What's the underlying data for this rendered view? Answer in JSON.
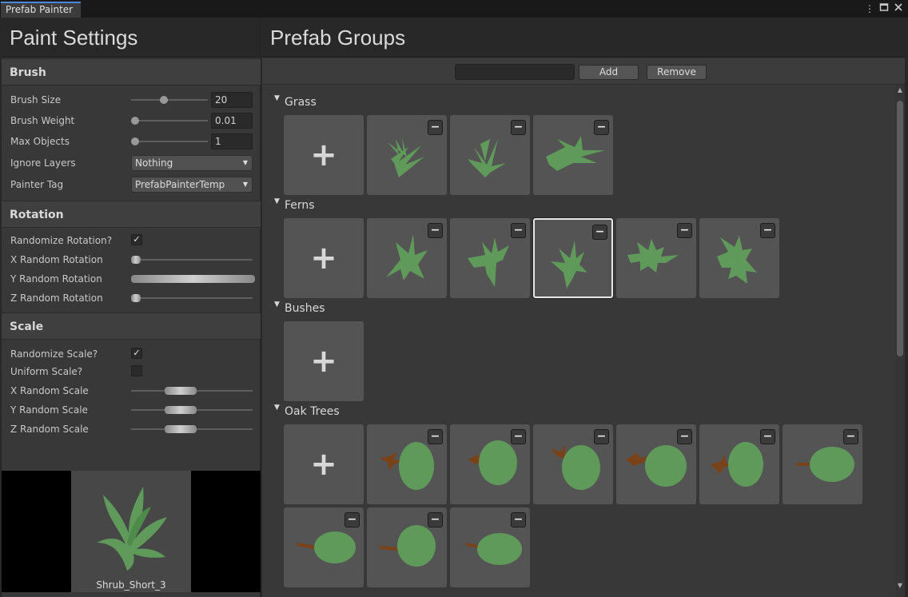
{
  "window": {
    "tab_label": "Prefab Painter",
    "menu_icon": "kebab-menu-icon",
    "maximize_icon": "maximize-icon",
    "close_icon": "close-icon"
  },
  "paint_settings": {
    "title": "Paint Settings",
    "brush": {
      "header": "Brush",
      "brush_size_label": "Brush Size",
      "brush_size_value": "20",
      "brush_size_level": 0.42,
      "brush_weight_label": "Brush Weight",
      "brush_weight_value": "0.01",
      "brush_weight_level": 0.0,
      "max_objects_label": "Max Objects",
      "max_objects_value": "1",
      "max_objects_level": 0.0,
      "ignore_layers_label": "Ignore Layers",
      "ignore_layers_value": "Nothing",
      "painter_tag_label": "Painter Tag",
      "painter_tag_value": "PrefabPainterTemp"
    },
    "rotation": {
      "header": "Rotation",
      "randomize_label": "Randomize Rotation?",
      "randomize_checked": true,
      "x_label": "X Random Rotation",
      "y_label": "Y Random Rotation",
      "z_label": "Z Random Rotation"
    },
    "scale": {
      "header": "Scale",
      "randomize_label": "Randomize Scale?",
      "randomize_checked": true,
      "uniform_label": "Uniform Scale?",
      "uniform_checked": false,
      "x_label": "X Random Scale",
      "y_label": "Y Random Scale",
      "z_label": "Z Random Scale"
    },
    "preview": {
      "name": "Shrub_Short_3"
    }
  },
  "prefab_groups": {
    "title": "Prefab Groups",
    "add_label": "Add",
    "remove_label": "Remove",
    "name_input_value": "",
    "add_icon": "plus-icon",
    "remove_icon": "minus-icon",
    "groups": [
      {
        "name": "Grass",
        "count": 3
      },
      {
        "name": "Ferns",
        "count": 5,
        "selected_index": 2
      },
      {
        "name": "Bushes",
        "count": 0
      },
      {
        "name": "Oak Trees",
        "count": 9
      }
    ]
  },
  "colors": {
    "foliage": "#5f9a5a",
    "trunk": "#7a4218",
    "panel_bg": "#383838",
    "title_bg": "#282828",
    "accent": "#4a8ad8"
  }
}
